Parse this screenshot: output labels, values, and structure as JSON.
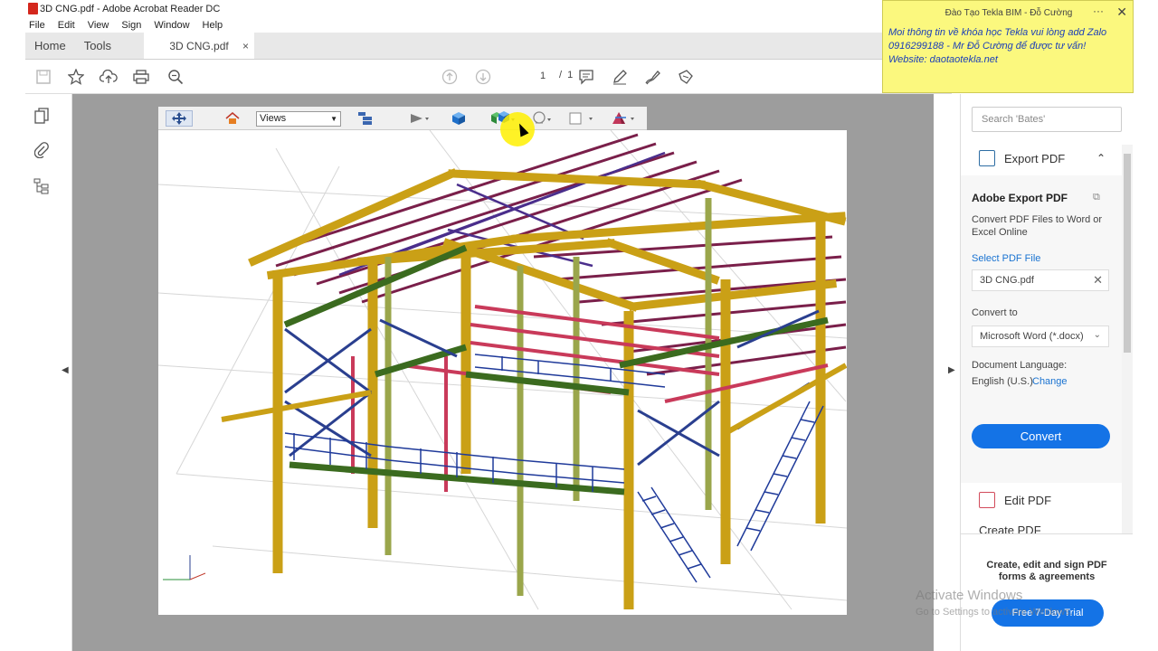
{
  "window": {
    "title": "3D CNG.pdf - Adobe Acrobat Reader DC"
  },
  "menu": [
    "File",
    "Edit",
    "View",
    "Sign",
    "Window",
    "Help"
  ],
  "tabs": {
    "home": "Home",
    "tools": "Tools",
    "document": "3D CNG.pdf",
    "close": "×"
  },
  "toolbar": {
    "page_current": "1",
    "page_sep": "/",
    "page_total": "1"
  },
  "viewer3d": {
    "views_label": "Views",
    "icons": [
      "rotate-tool-icon",
      "home-view-icon",
      "views-dropdown",
      "model-tree-icon",
      "play-icon",
      "cube-icon",
      "render-mode-icon",
      "lighting-icon",
      "background-color-icon",
      "cross-section-icon"
    ]
  },
  "side_panel": {
    "search_placeholder": "Search 'Bates'",
    "export_header": "Export PDF",
    "adobe_export": "Adobe Export PDF",
    "description": "Convert PDF Files to Word or Excel Online",
    "select_file": "Select PDF File",
    "file_name": "3D CNG.pdf",
    "convert_to": "Convert to",
    "format": "Microsoft Word (*.docx)",
    "doc_language": "Document Language:",
    "language": "English (U.S.)",
    "change": "Change",
    "convert_button": "Convert",
    "edit_pdf": "Edit PDF",
    "create_pdf": "Create PDF",
    "promo_text": "Create, edit and sign PDF forms & agreements",
    "trial_button": "Free 7-Day Trial"
  },
  "notification": {
    "title": "Đào Tạo Tekla BIM - Đỗ Cường",
    "line1": "Moi thông tin về khóa học Tekla vui lòng add Zalo",
    "line2": "0916299188 - Mr Đỗ Cường để được tư vấn!",
    "line3": "Website: daotaotekla.net"
  },
  "watermark": {
    "line1": "Activate Windows",
    "line2": "Go to Settings to activate Windows."
  },
  "colors": {
    "accent": "#1473e6",
    "column": "#d4a017",
    "secondary": "#7a1f4a",
    "bracing": "#2a3f8f",
    "rail": "#1f3a9a",
    "platform": "#3b6b1f"
  }
}
